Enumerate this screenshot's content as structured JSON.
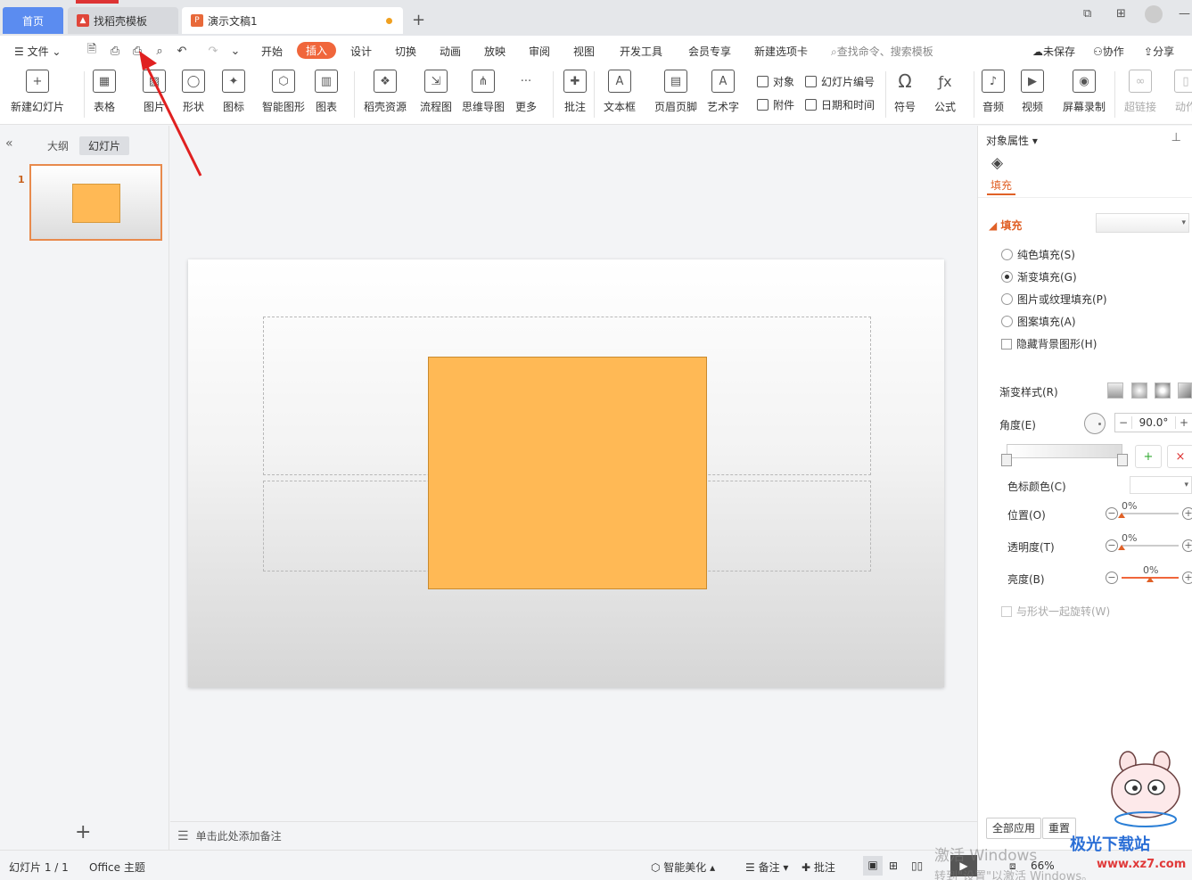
{
  "tabs": {
    "home": "首页",
    "template": "找稻壳模板",
    "doc": "演示文稿1",
    "add": "+"
  },
  "menu": {
    "file": "文件",
    "items": [
      "开始",
      "插入",
      "设计",
      "切换",
      "动画",
      "放映",
      "审阅",
      "视图",
      "开发工具",
      "会员专享",
      "新建选项卡"
    ],
    "active": "插入",
    "search_placeholder": "查找命令、搜索模板",
    "unsaved": "未保存",
    "collab": "协作",
    "share": "分享"
  },
  "ribbon": {
    "new_slide": "新建幻灯片",
    "table": "表格",
    "picture": "图片",
    "shape": "形状",
    "icon": "图标",
    "smartart": "智能图形",
    "chart": "图表",
    "daoke": "稻壳资源",
    "flowchart": "流程图",
    "mindmap": "思维导图",
    "more": "更多",
    "comment": "批注",
    "textbox": "文本框",
    "header_footer": "页眉页脚",
    "wordart": "艺术字",
    "object": "对象",
    "slide_number": "幻灯片编号",
    "attachment": "附件",
    "datetime": "日期和时间",
    "symbol": "符号",
    "formula": "公式",
    "audio": "音频",
    "video": "视频",
    "screen_record": "屏幕录制",
    "hyperlink": "超链接",
    "action": "动作"
  },
  "left_panel": {
    "outline_tab": "大纲",
    "slides_tab": "幻灯片",
    "slide_number": "1"
  },
  "notes_placeholder": "单击此处添加备注",
  "right_panel": {
    "title": "对象属性",
    "fill_tab": "填充",
    "section": "填充",
    "options": [
      {
        "label": "纯色填充(S)",
        "checked": false
      },
      {
        "label": "渐变填充(G)",
        "checked": true
      },
      {
        "label": "图片或纹理填充(P)",
        "checked": false
      },
      {
        "label": "图案填充(A)",
        "checked": false
      }
    ],
    "hide_bg": "隐藏背景图形(H)",
    "gradient_style": "渐变样式(R)",
    "angle_label": "角度(E)",
    "angle_value": "90.0°",
    "stop_color": "色标颜色(C)",
    "position": {
      "label": "位置(O)",
      "value": "0%"
    },
    "transparency": {
      "label": "透明度(T)",
      "value": "0%"
    },
    "brightness": {
      "label": "亮度(B)",
      "value": "0%"
    },
    "rotate_with_shape": "与形状一起旋转(W)",
    "apply_all": "全部应用",
    "reset": "重置"
  },
  "statusbar": {
    "slide_info": "幻灯片 1 / 1",
    "theme": "Office 主题",
    "beautify": "智能美化",
    "notes": "备注",
    "comments": "批注",
    "zoom": "66%"
  },
  "overlay": {
    "activate_line1": "激活 Windows",
    "activate_line2": "转到\"设置\"以激活 Windows。",
    "site_logo": "极光下载站",
    "site_url": "www.xz7.com"
  },
  "colors": {
    "accent": "#f0663b",
    "shape_fill": "#ffb955",
    "home_tab": "#5b8cf0"
  }
}
